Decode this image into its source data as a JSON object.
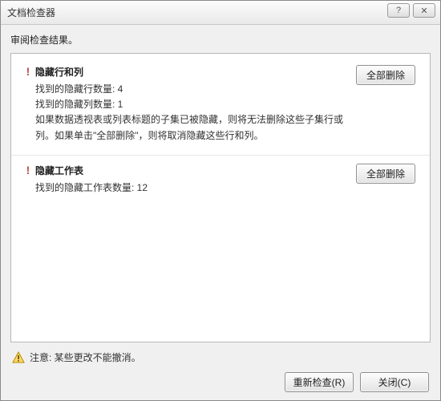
{
  "titlebar": {
    "title": "文档检查器",
    "help_glyph": "?",
    "close_glyph": "✕"
  },
  "subheading": "审阅检查结果。",
  "results": [
    {
      "title": "隐藏行和列",
      "lines": [
        "找到的隐藏行数量: 4",
        "找到的隐藏列数量: 1",
        "如果数据透视表或列表标题的子集已被隐藏，则将无法删除这些子集行或列。如果单击\"全部删除\"，则将取消隐藏这些行和列。"
      ],
      "action_label": "全部删除"
    },
    {
      "title": "隐藏工作表",
      "lines": [
        "找到的隐藏工作表数量: 12"
      ],
      "action_label": "全部删除"
    }
  ],
  "footer": {
    "note": "注意: 某些更改不能撤消。",
    "reinspect": "重新检查(R)",
    "close": "关闭(C)"
  }
}
